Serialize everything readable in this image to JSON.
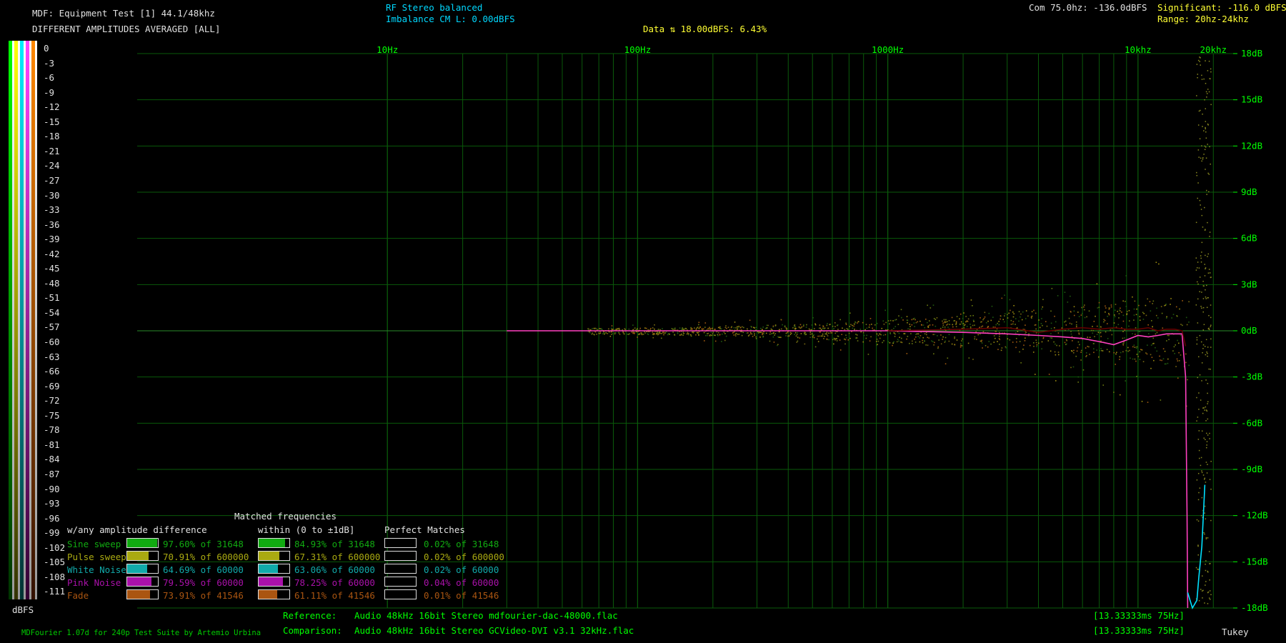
{
  "header": {
    "title": "MDF: Equipment Test [1] 44.1/48khz",
    "subtitle": "DIFFERENT AMPLITUDES AVERAGED [ALL]",
    "rf_line1": "RF Stereo balanced",
    "rf_line2": "Imbalance CM L: 0.00dBFS",
    "data_line": "Data ⇅ 18.00dBFS: 6.43%",
    "com": "Com 75.0hz: -136.0dBFS",
    "significant": "Significant: -116.0 dBFS",
    "range": "Range: 20hz-24khz"
  },
  "scale": {
    "labels": [
      "0",
      "-3",
      "-6",
      "-9",
      "-12",
      "-15",
      "-18",
      "-21",
      "-24",
      "-27",
      "-30",
      "-33",
      "-36",
      "-39",
      "-42",
      "-45",
      "-48",
      "-51",
      "-54",
      "-57",
      "-60",
      "-63",
      "-66",
      "-69",
      "-72",
      "-75",
      "-78",
      "-81",
      "-84",
      "-87",
      "-90",
      "-93",
      "-96",
      "-99",
      "-102",
      "-105",
      "-108",
      "-111"
    ],
    "unit": "dBFS",
    "strip_colors": [
      "#00ff00",
      "#ffff00",
      "#00e0ff",
      "#ff40ff",
      "#ff8000"
    ]
  },
  "colors": {
    "grid": "#0a5a0a",
    "axis_text": "#00ff00",
    "sine": "#11aa11",
    "pulse": "#aaaa11",
    "white": "#11aaaa",
    "pink": "#aa11aa",
    "fade": "#aa5511",
    "avg_pink": "#ff40c0",
    "avg_dark": "#600000",
    "white_line": "#00e0ff"
  },
  "stats": {
    "title_matched": "Matched frequencies",
    "col1_header": "w/any amplitude difference",
    "col2_header": "within (0 to ±1dB]",
    "col3_header": "Perfect Matches",
    "rows": [
      {
        "name": "Sine sweep",
        "color": "#11aa11",
        "c1": "97.60% of 31648",
        "c1f": 0.976,
        "c2": "84.93% of 31648",
        "c2f": 0.8493,
        "c3": "0.02% of 31648",
        "c3f": 0.0002
      },
      {
        "name": "Pulse sweep",
        "color": "#aaaa11",
        "c1": "70.91% of 600000",
        "c1f": 0.7091,
        "c2": "67.31% of 600000",
        "c2f": 0.6731,
        "c3": "0.02% of 600000",
        "c3f": 0.0002
      },
      {
        "name": "White Noise",
        "color": "#11aaaa",
        "c1": "64.69% of 60000",
        "c1f": 0.6469,
        "c2": "63.06% of 60000",
        "c2f": 0.6306,
        "c3": "0.02% of 60000",
        "c3f": 0.0002
      },
      {
        "name": "Pink Noise",
        "color": "#aa11aa",
        "c1": "79.59% of 60000",
        "c1f": 0.7959,
        "c2": "78.25% of 60000",
        "c2f": 0.7825,
        "c3": "0.04% of 60000",
        "c3f": 0.0004
      },
      {
        "name": "Fade",
        "color": "#aa5511",
        "c1": "73.91% of 41546",
        "c1f": 0.7391,
        "c2": "61.11% of 41546",
        "c2f": 0.6111,
        "c3": "0.01% of 41546",
        "c3f": 0.0001
      }
    ]
  },
  "footer": {
    "credit": "MDFourier 1.07d for 240p Test Suite by Artemio Urbina",
    "ref_label": "Reference:",
    "ref_file": "Audio    48kHz 16bit Stereo mdfourier-dac-48000.flac",
    "cmp_label": "Comparison:",
    "cmp_file": "Audio    48kHz 16bit Stereo GCVideo-DVI v3.1 32kHz.flac",
    "ref_frame": "[13.33333ms 75Hz]",
    "cmp_frame": "[13.33333ms 75Hz]",
    "window": "Tukey"
  },
  "chart_data": {
    "type": "scatter",
    "title": "DIFFERENT AMPLITUDES AVERAGED [ALL]",
    "xlabel": "",
    "ylabel": "",
    "x_scale": "log",
    "xlim": [
      1,
      24000
    ],
    "ylim": [
      -18,
      18
    ],
    "grid": true,
    "x_ticks": [
      {
        "v": 10,
        "label": "10Hz"
      },
      {
        "v": 100,
        "label": "100Hz"
      },
      {
        "v": 1000,
        "label": "1000Hz"
      },
      {
        "v": 10000,
        "label": "10khz"
      },
      {
        "v": 20000,
        "label": "20khz"
      }
    ],
    "y_ticks": [
      {
        "v": 18,
        "label": "18dB"
      },
      {
        "v": 15,
        "label": "15dB"
      },
      {
        "v": 12,
        "label": "12dB"
      },
      {
        "v": 9,
        "label": "9dB"
      },
      {
        "v": 6,
        "label": "6dB"
      },
      {
        "v": 3,
        "label": "3dB"
      },
      {
        "v": 0,
        "label": "0dB"
      },
      {
        "v": -3,
        "label": "-3dB"
      },
      {
        "v": -6,
        "label": "-6dB"
      },
      {
        "v": -9,
        "label": "-9dB"
      },
      {
        "v": -12,
        "label": "-12dB"
      },
      {
        "v": -15,
        "label": "-15dB"
      },
      {
        "v": -18,
        "label": "-18dB"
      }
    ],
    "series": [
      {
        "name": "Average (pink)",
        "x": [
          30,
          60,
          100,
          200,
          500,
          1000,
          2000,
          3000,
          4000,
          5000,
          6000,
          7000,
          8000,
          9000,
          10000,
          11000,
          12000,
          13000,
          14000,
          15000,
          15500,
          15700,
          15800
        ],
        "y": [
          0,
          0,
          0,
          0,
          0,
          0,
          -0.1,
          -0.2,
          -0.3,
          -0.4,
          -0.5,
          -0.7,
          -0.9,
          -0.6,
          -0.3,
          -0.4,
          -0.3,
          -0.2,
          -0.2,
          -0.2,
          -3,
          -12,
          -18
        ]
      },
      {
        "name": "Average (dark)",
        "x": [
          1000,
          2000,
          3000,
          4000,
          5000,
          6000,
          7000,
          8000,
          9000,
          10000,
          11000,
          12000,
          13000,
          14000,
          15000,
          15500
        ],
        "y": [
          0,
          0.1,
          0.2,
          -0.1,
          0.1,
          0.2,
          0.1,
          0.2,
          0.1,
          0.1,
          0.2,
          0,
          0.1,
          0.1,
          0,
          -1
        ]
      },
      {
        "name": "White Noise",
        "x": [
          15800,
          16500,
          17200,
          17500,
          18000,
          18500
        ],
        "y": [
          -17,
          -18,
          -17.5,
          -16,
          -14,
          -10
        ]
      }
    ]
  }
}
